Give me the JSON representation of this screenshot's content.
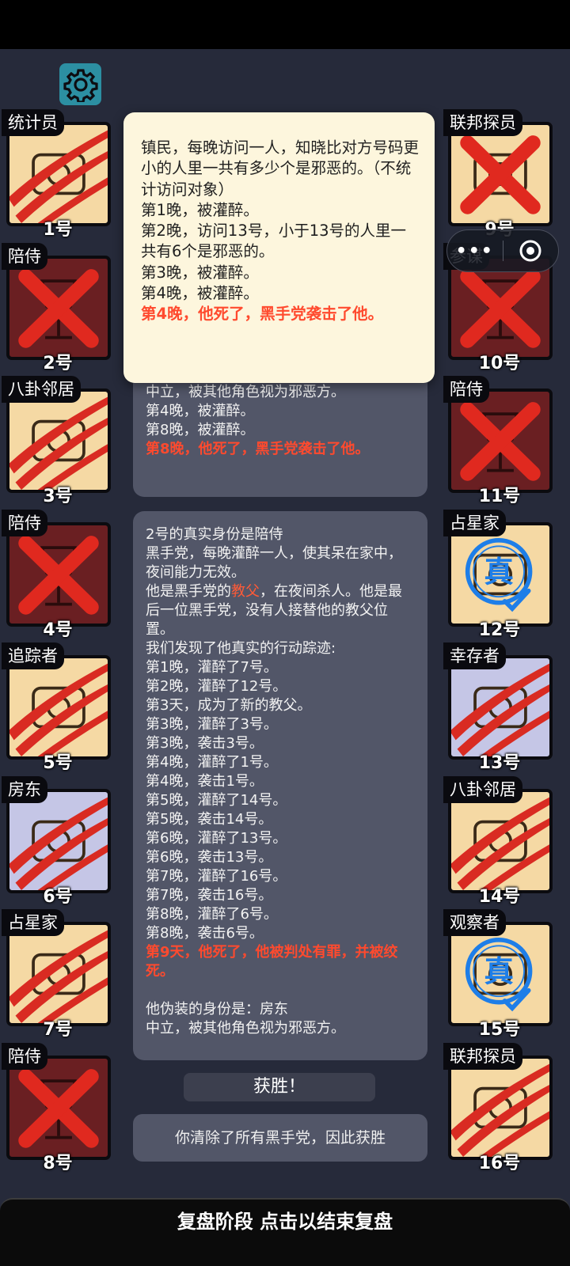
{
  "popup_lines": [
    {
      "text": "镇民，每晚访问一人，知晓比对方号码更小的人里一共有多少个是邪恶的。（不统计访问对象）",
      "red": false
    },
    {
      "text": "第1晚，被灌醉。",
      "red": false
    },
    {
      "text": "第2晚，访问13号，小于13号的人里一共有6个是邪恶的。",
      "red": false
    },
    {
      "text": "第3晚，被灌醉。",
      "red": false
    },
    {
      "text": "第4晚，被灌醉。",
      "red": false
    },
    {
      "text": "第4晚，他死了，黑手党袭击了他。",
      "red": true
    }
  ],
  "panel1_lines": [
    {
      "text": "中立，被其他角色视为邪恶方。",
      "red": false
    },
    {
      "text": "第4晚，被灌醉。",
      "red": false
    },
    {
      "text": "第8晚，被灌醉。",
      "red": false
    },
    {
      "text": "第8晚，他死了，黑手党袭击了他。",
      "red": true
    }
  ],
  "panel2": {
    "intro": "2号的真实身份是陪侍",
    "desc1": "黑手党，每晚灌醉一人，使其呆在家中，夜间能力无效。",
    "desc2_pre": "他是黑手党的",
    "desc2_hl": "教父",
    "desc2_post": "，在夜间杀人。他是最后一位黑手党，没有人接替他的教父位置。",
    "found": "我们发现了他真实的行动踪迹:",
    "actions": [
      "第1晚，灌醉了7号。",
      "第2晚，灌醉了12号。",
      "第3天，成为了新的教父。",
      "第3晚，灌醉了3号。",
      "第3晚，袭击3号。",
      "第4晚，灌醉了1号。",
      "第4晚，袭击1号。",
      "第5晚，灌醉了14号。",
      "第5晚，袭击14号。",
      "第6晚，灌醉了13号。",
      "第6晚，袭击13号。",
      "第7晚，灌醉了16号。",
      "第7晚，袭击16号。",
      "第8晚，灌醉了6号。",
      "第8晚，袭击6号。"
    ],
    "death": "第9天，他死了，他被判处有罪，并被绞死。",
    "disguise": "他伪装的身份是：房东",
    "disguise_desc": "中立，被其他角色视为邪恶方。"
  },
  "win_button": "获胜！",
  "win_message": "你清除了所有黑手党，因此获胜",
  "bottom_bar": "复盘阶段 点击以结束复盘",
  "mini_program": {
    "dots": "•••",
    "target_icon": "target-icon"
  },
  "settings_icon": "gear-icon",
  "colors": {
    "evil": "#ff4a2e",
    "alive": "#f5d9a4",
    "dead": "#6a1f22",
    "neutral": "#c5c6e6",
    "true_stamp": "#1e7ee8"
  },
  "players": [
    {
      "num": "1号",
      "role": "统计员",
      "status": "slashed"
    },
    {
      "num": "2号",
      "role": "陪侍",
      "status": "dead"
    },
    {
      "num": "3号",
      "role": "八卦邻居",
      "status": "slashed"
    },
    {
      "num": "4号",
      "role": "陪侍",
      "status": "dead"
    },
    {
      "num": "5号",
      "role": "追踪者",
      "status": "slashed"
    },
    {
      "num": "6号",
      "role": "房东",
      "status": "slashed",
      "tint": "blue"
    },
    {
      "num": "7号",
      "role": "占星家",
      "status": "slashed"
    },
    {
      "num": "8号",
      "role": "陪侍",
      "status": "dead"
    },
    {
      "num": "9号",
      "role": "联邦探员",
      "status": "crossed"
    },
    {
      "num": "10号",
      "role": "参谋",
      "status": "dead"
    },
    {
      "num": "11号",
      "role": "陪侍",
      "status": "dead"
    },
    {
      "num": "12号",
      "role": "占星家",
      "status": "true",
      "stamp": "真"
    },
    {
      "num": "13号",
      "role": "幸存者",
      "status": "slashed",
      "tint": "blue"
    },
    {
      "num": "14号",
      "role": "八卦邻居",
      "status": "slashed"
    },
    {
      "num": "15号",
      "role": "观察者",
      "status": "true",
      "stamp": "真"
    },
    {
      "num": "16号",
      "role": "联邦探员",
      "status": "slashed"
    }
  ]
}
